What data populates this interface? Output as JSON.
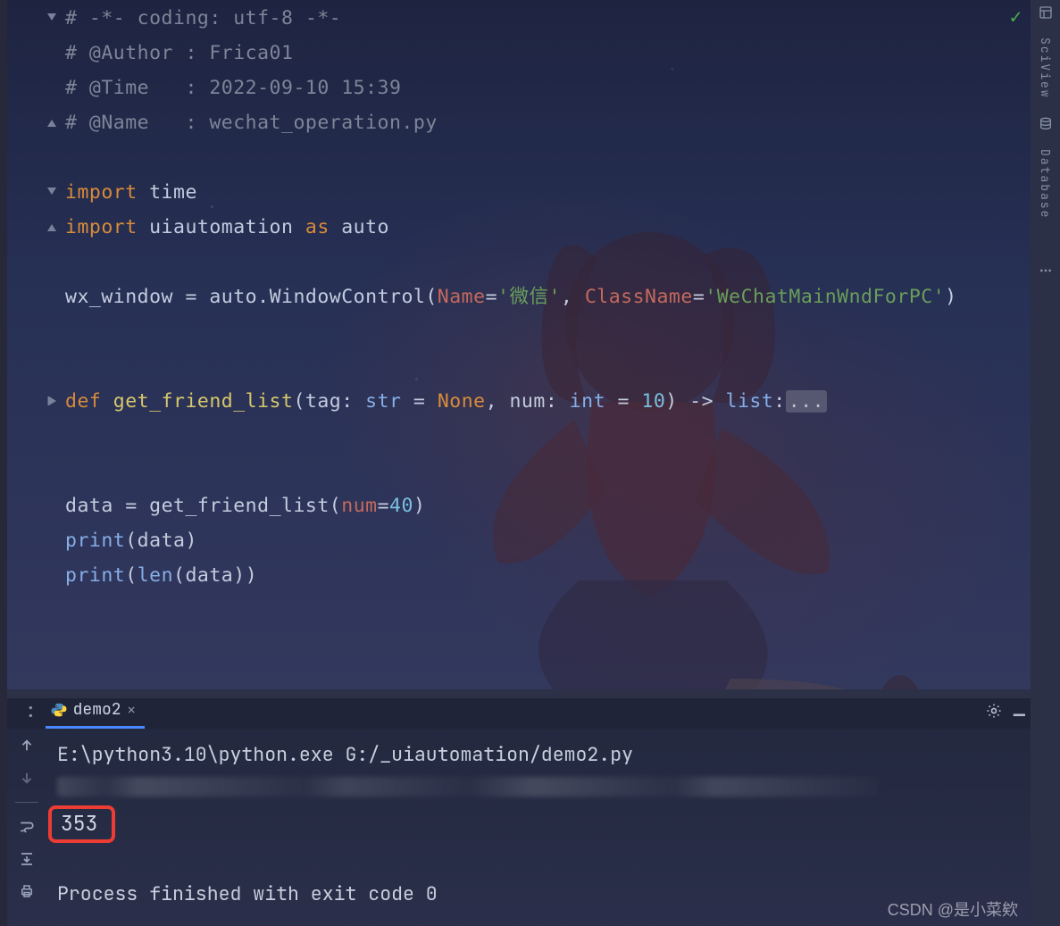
{
  "editor": {
    "status_check": "✓",
    "code": {
      "l1": {
        "cm": "# -*- coding: utf-8 -*-"
      },
      "l2": {
        "cm": "# @Author : Frica01"
      },
      "l3": {
        "cm": "# @Time   : 2022-09-10 15:39"
      },
      "l4": {
        "cm": "# @Name   : wechat_operation.py"
      },
      "l6a": "import",
      "l6b": " time",
      "l7a": "import",
      "l7b": " uiautomation ",
      "l7c": "as",
      "l7d": " auto",
      "l9a": "wx_window ",
      "l9eq": "=",
      "l9b": " auto.WindowControl(",
      "l9name": "Name",
      "l9eq2": "=",
      "l9s1": "'微信'",
      "l9comma": ", ",
      "l9cls": "ClassName",
      "l9eq3": "=",
      "l9s2": "'WeChatMainWndForPC'",
      "l9end": ")",
      "l12def": "def",
      "l12fn": " get_friend_list",
      "l12p1": "(tag: ",
      "l12str": "str",
      "l12p2": " = ",
      "l12none": "None",
      "l12p3": ", num: ",
      "l12int": "int",
      "l12p4": " = ",
      "l12n": "10",
      "l12p5": ") -> ",
      "l12list": "list",
      "l12colon": ":",
      "l12ell": "...",
      "l15a": "data ",
      "l15eq": "=",
      "l15b": " get_friend_list(",
      "l15num": "num",
      "l15eq2": "=",
      "l15v": "40",
      "l15end": ")",
      "l16a": "print",
      "l16b": "(data)",
      "l17a": "print",
      "l17b": "(",
      "l17len": "len",
      "l17c": "(data))"
    }
  },
  "sidebar": {
    "label1": "SciView",
    "label2": "Database"
  },
  "console": {
    "tab_name": "demo2",
    "lines": {
      "cmd": "E:\\python3.10\\python.exe G:/_uiautomation/demo2.py",
      "out_number": "353",
      "exit": "Process finished with exit code 0"
    }
  },
  "watermark": "CSDN @是小菜欸"
}
